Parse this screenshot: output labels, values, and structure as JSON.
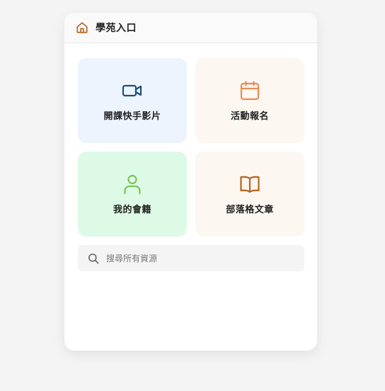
{
  "header": {
    "title": "學苑入口",
    "icon": "home-icon"
  },
  "tiles": [
    {
      "label": "開課快手影片",
      "icon": "video-camera-icon",
      "bg": "#eef4fe",
      "accent": "#1d4f7a"
    },
    {
      "label": "活動報名",
      "icon": "calendar-icon",
      "bg": "#fdf7f2",
      "accent": "#ea8a55"
    },
    {
      "label": "我的會籍",
      "icon": "user-icon",
      "bg": "#ddfae6",
      "accent": "#7cc35a"
    },
    {
      "label": "部落格文章",
      "icon": "open-book-icon",
      "bg": "#fdf7f2",
      "accent": "#b8641c"
    }
  ],
  "search": {
    "placeholder": "搜尋所有資源",
    "value": "",
    "icon": "search-icon"
  },
  "colors": {
    "page_bg": "#f4f4f4",
    "header_icon": "#b8641c"
  }
}
